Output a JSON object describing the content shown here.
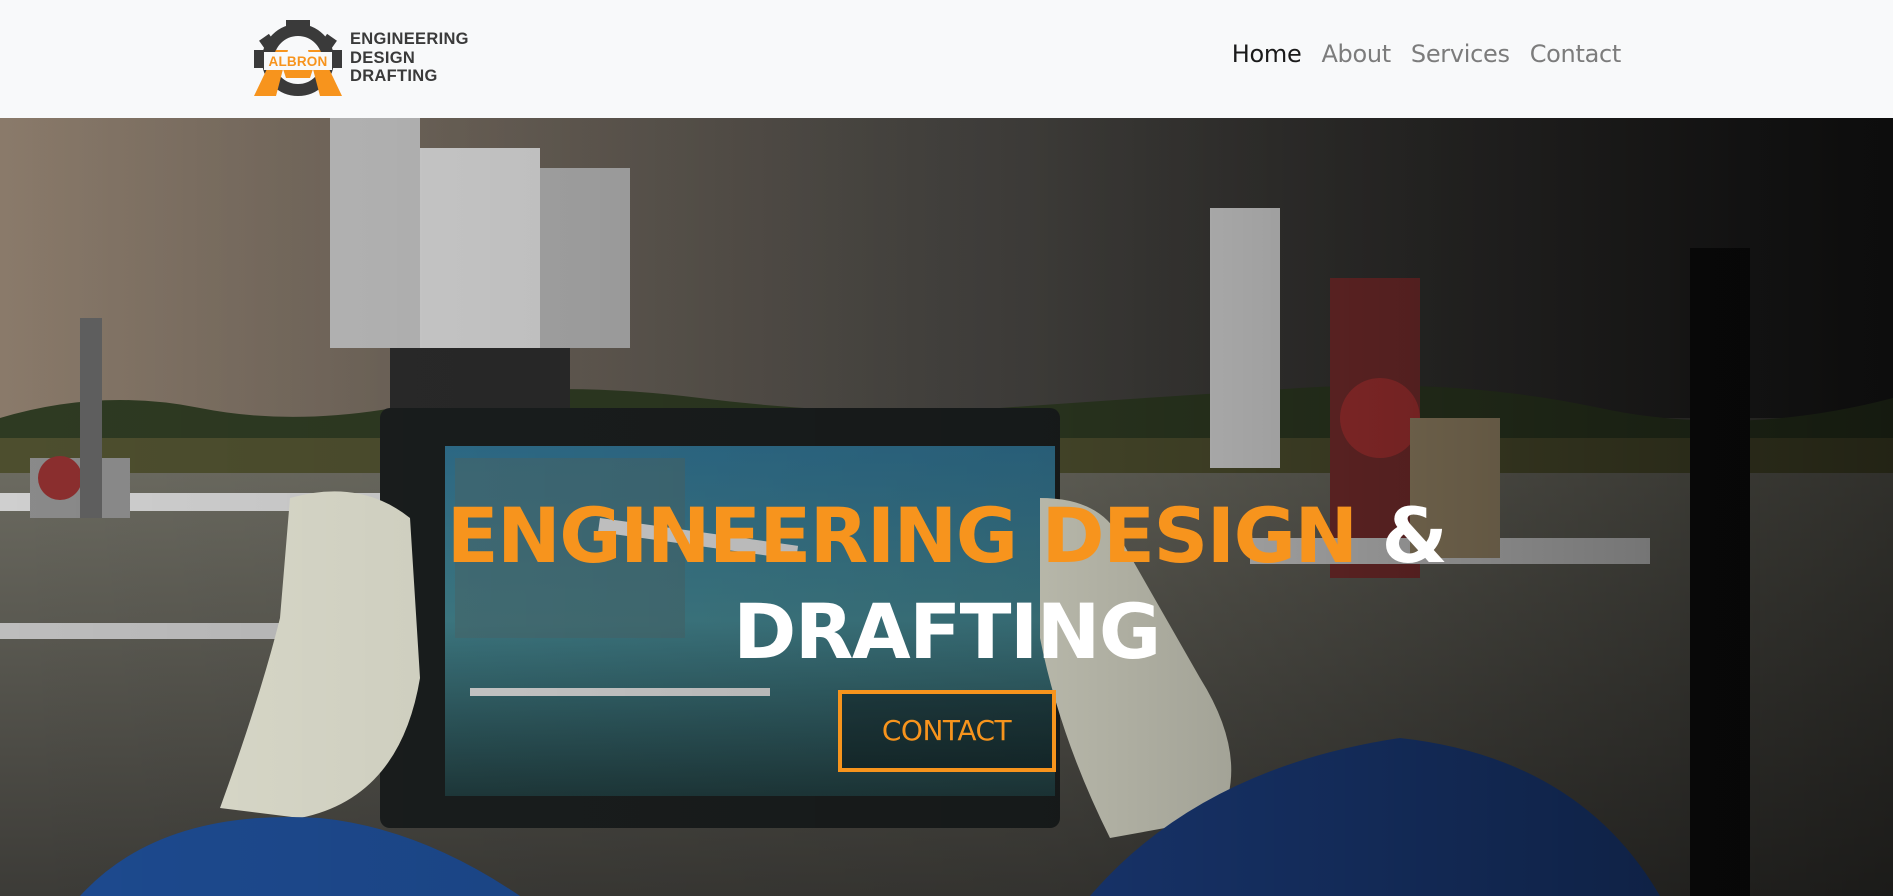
{
  "brand": {
    "logo_text": "ALBRON",
    "line1": "ENGINEERING",
    "line2": "DESIGN",
    "line3": "DRAFTING",
    "accent_color": "#f7941d"
  },
  "nav": {
    "home": "Home",
    "about": "About",
    "services": "Services",
    "contact": "Contact"
  },
  "hero": {
    "headline_accent": "ENGINEERING DESIGN",
    "headline_amp": "&",
    "headline_rest": "DRAFTING",
    "cta_label": "CONTACT",
    "background_icon": "industrial-site-photo"
  }
}
